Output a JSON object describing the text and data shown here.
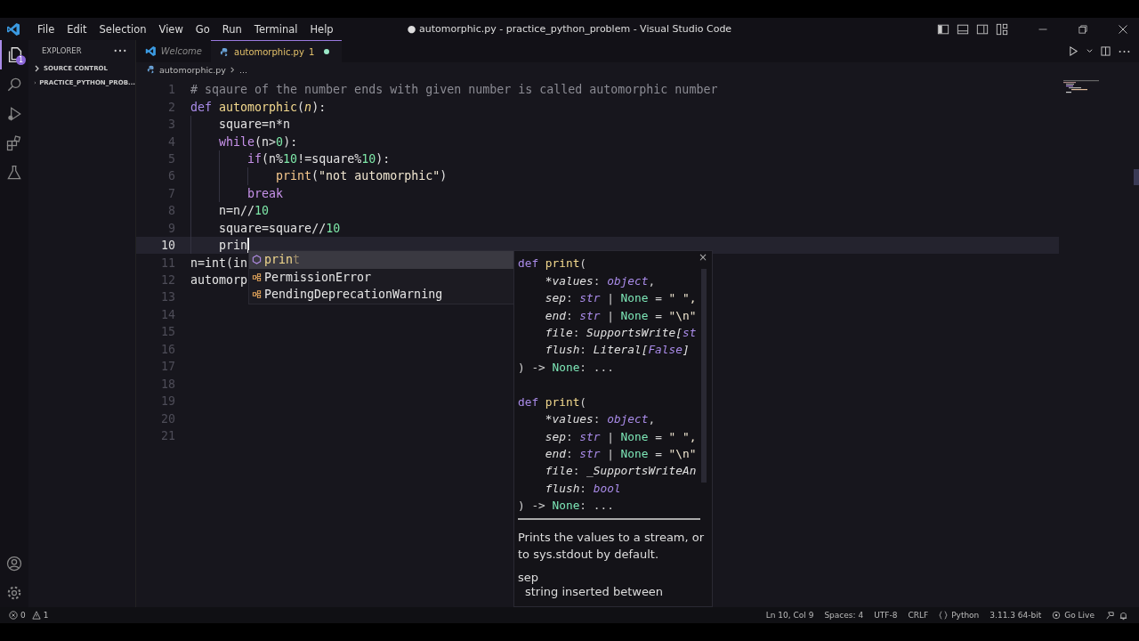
{
  "window": {
    "title": "● automorphic.py - practice_python_problem - Visual Studio Code"
  },
  "menu": [
    "File",
    "Edit",
    "Selection",
    "View",
    "Go",
    "Run",
    "Terminal",
    "Help"
  ],
  "activity_bar": {
    "explorer_badge": "1"
  },
  "sidebar": {
    "title": "EXPLORER",
    "items": [
      {
        "label": "SOURCE CONTROL",
        "expanded": false
      },
      {
        "label": "PRACTICE_PYTHON_PROB...",
        "expanded": false
      }
    ]
  },
  "tabs": [
    {
      "label": "Welcome",
      "kind": "welcome",
      "selected": false,
      "modified": false
    },
    {
      "label": "automorphic.py",
      "kind": "python",
      "selected": true,
      "problems": "1",
      "modified": true
    }
  ],
  "breadcrumb": [
    "automorphic.py",
    "..."
  ],
  "editor": {
    "lines": [
      {
        "number": "1",
        "current": false,
        "tokens": [
          {
            "kind": "cmt",
            "text": "# sqaure of the number ends with given number is called automorphic number"
          }
        ]
      },
      {
        "number": "2",
        "current": false,
        "tokens": [
          {
            "kind": "def",
            "text": "def "
          },
          {
            "kind": "fn",
            "text": "automorphic"
          },
          {
            "kind": "op",
            "text": "("
          },
          {
            "kind": "param",
            "text": "n"
          },
          {
            "kind": "op",
            "text": "):"
          }
        ]
      },
      {
        "number": "3",
        "current": false,
        "tokens": [
          {
            "kind": "var",
            "text": "    square"
          },
          {
            "kind": "op",
            "text": "="
          },
          {
            "kind": "var",
            "text": "n"
          },
          {
            "kind": "op",
            "text": "*"
          },
          {
            "kind": "var",
            "text": "n"
          }
        ]
      },
      {
        "number": "4",
        "current": false,
        "tokens": [
          {
            "kind": "kw",
            "text": "    while"
          },
          {
            "kind": "op",
            "text": "("
          },
          {
            "kind": "var",
            "text": "n"
          },
          {
            "kind": "op",
            "text": ">"
          },
          {
            "kind": "num",
            "text": "0"
          },
          {
            "kind": "op",
            "text": "):"
          }
        ]
      },
      {
        "number": "5",
        "current": false,
        "tokens": [
          {
            "kind": "kw",
            "text": "        if"
          },
          {
            "kind": "op",
            "text": "("
          },
          {
            "kind": "var",
            "text": "n"
          },
          {
            "kind": "op",
            "text": "%"
          },
          {
            "kind": "num",
            "text": "10"
          },
          {
            "kind": "op",
            "text": "!="
          },
          {
            "kind": "var",
            "text": "square"
          },
          {
            "kind": "op",
            "text": "%"
          },
          {
            "kind": "num",
            "text": "10"
          },
          {
            "kind": "op",
            "text": "):"
          }
        ]
      },
      {
        "number": "6",
        "current": false,
        "tokens": [
          {
            "kind": "call",
            "text": "            print"
          },
          {
            "kind": "op",
            "text": "("
          },
          {
            "kind": "str",
            "text": "\"not automorphic\""
          },
          {
            "kind": "op",
            "text": ")"
          }
        ]
      },
      {
        "number": "7",
        "current": false,
        "tokens": [
          {
            "kind": "kw",
            "text": "        break"
          }
        ]
      },
      {
        "number": "8",
        "current": false,
        "tokens": [
          {
            "kind": "var",
            "text": "    n"
          },
          {
            "kind": "op",
            "text": "="
          },
          {
            "kind": "var",
            "text": "n"
          },
          {
            "kind": "op",
            "text": "//"
          },
          {
            "kind": "num",
            "text": "10"
          }
        ]
      },
      {
        "number": "9",
        "current": false,
        "tokens": [
          {
            "kind": "var",
            "text": "    square"
          },
          {
            "kind": "op",
            "text": "="
          },
          {
            "kind": "var",
            "text": "square"
          },
          {
            "kind": "op",
            "text": "//"
          },
          {
            "kind": "num",
            "text": "10"
          }
        ]
      },
      {
        "number": "10",
        "current": true,
        "tokens": [
          {
            "kind": "var",
            "text": "    prin"
          }
        ]
      },
      {
        "number": "11",
        "current": false,
        "tokens": [
          {
            "kind": "var",
            "text": "n"
          },
          {
            "kind": "op",
            "text": "="
          },
          {
            "kind": "var",
            "text": "int"
          },
          {
            "kind": "op",
            "text": "("
          },
          {
            "kind": "var",
            "text": "in"
          }
        ]
      },
      {
        "number": "12",
        "current": false,
        "tokens": [
          {
            "kind": "var",
            "text": "automorp"
          }
        ]
      },
      {
        "number": "13",
        "current": false
      },
      {
        "number": "14",
        "current": false
      },
      {
        "number": "15",
        "current": false
      },
      {
        "number": "16",
        "current": false
      },
      {
        "number": "17",
        "current": false
      },
      {
        "number": "18",
        "current": false
      },
      {
        "number": "19",
        "current": false
      },
      {
        "number": "20",
        "current": false
      },
      {
        "number": "21",
        "current": false
      }
    ]
  },
  "suggestions": [
    {
      "kind": "method",
      "match": "prin",
      "rest": "t",
      "selected": true
    },
    {
      "kind": "class",
      "match": "P",
      "rest": "ermissionError",
      "selected": false
    },
    {
      "kind": "class",
      "match": "P",
      "rest": "endingDeprecationWarning",
      "selected": false
    }
  ],
  "hover": {
    "close": "×",
    "signatures": [
      [
        [
          {
            "kind": "def",
            "text": "def "
          },
          {
            "kind": "fn",
            "text": "print"
          },
          {
            "kind": "op",
            "text": "("
          }
        ],
        [
          {
            "kind": "ital",
            "text": "    *values"
          },
          {
            "kind": "op",
            "text": ": "
          },
          {
            "kind": "type",
            "text": "object"
          },
          {
            "kind": "op",
            "text": ","
          }
        ],
        [
          {
            "kind": "ital",
            "text": "    sep"
          },
          {
            "kind": "op",
            "text": ": "
          },
          {
            "kind": "type",
            "text": "str"
          },
          {
            "kind": "op",
            "text": " | "
          },
          {
            "kind": "none",
            "text": "None"
          },
          {
            "kind": "op",
            "text": " = "
          },
          {
            "kind": "str",
            "text": "\" \","
          }
        ],
        [
          {
            "kind": "ital",
            "text": "    end"
          },
          {
            "kind": "op",
            "text": ": "
          },
          {
            "kind": "type",
            "text": "str"
          },
          {
            "kind": "op",
            "text": " | "
          },
          {
            "kind": "none",
            "text": "None"
          },
          {
            "kind": "op",
            "text": " = "
          },
          {
            "kind": "str",
            "text": "\"\\n\""
          }
        ],
        [
          {
            "kind": "ital",
            "text": "    file"
          },
          {
            "kind": "op",
            "text": ": "
          },
          {
            "kind": "ital",
            "text": "SupportsWrite["
          },
          {
            "kind": "type",
            "text": "st"
          }
        ],
        [
          {
            "kind": "ital",
            "text": "    flush"
          },
          {
            "kind": "op",
            "text": ": "
          },
          {
            "kind": "ital",
            "text": "Literal["
          },
          {
            "kind": "type",
            "text": "False"
          },
          {
            "kind": "ital",
            "text": "]"
          }
        ],
        [
          {
            "kind": "op",
            "text": ") -> "
          },
          {
            "kind": "none",
            "text": "None"
          },
          {
            "kind": "op",
            "text": ": ..."
          }
        ]
      ],
      [
        [
          {
            "kind": "def",
            "text": "def "
          },
          {
            "kind": "fn",
            "text": "print"
          },
          {
            "kind": "op",
            "text": "("
          }
        ],
        [
          {
            "kind": "ital",
            "text": "    *values"
          },
          {
            "kind": "op",
            "text": ": "
          },
          {
            "kind": "type",
            "text": "object"
          },
          {
            "kind": "op",
            "text": ","
          }
        ],
        [
          {
            "kind": "ital",
            "text": "    sep"
          },
          {
            "kind": "op",
            "text": ": "
          },
          {
            "kind": "type",
            "text": "str"
          },
          {
            "kind": "op",
            "text": " | "
          },
          {
            "kind": "none",
            "text": "None"
          },
          {
            "kind": "op",
            "text": " = "
          },
          {
            "kind": "str",
            "text": "\" \","
          }
        ],
        [
          {
            "kind": "ital",
            "text": "    end"
          },
          {
            "kind": "op",
            "text": ": "
          },
          {
            "kind": "type",
            "text": "str"
          },
          {
            "kind": "op",
            "text": " | "
          },
          {
            "kind": "none",
            "text": "None"
          },
          {
            "kind": "op",
            "text": " = "
          },
          {
            "kind": "str",
            "text": "\"\\n\""
          }
        ],
        [
          {
            "kind": "ital",
            "text": "    file"
          },
          {
            "kind": "op",
            "text": ": "
          },
          {
            "kind": "ital",
            "text": "_SupportsWriteAn"
          }
        ],
        [
          {
            "kind": "ital",
            "text": "    flush"
          },
          {
            "kind": "op",
            "text": ": "
          },
          {
            "kind": "type",
            "text": "bool"
          }
        ],
        [
          {
            "kind": "op",
            "text": ") -> "
          },
          {
            "kind": "none",
            "text": "None"
          },
          {
            "kind": "op",
            "text": ": ..."
          }
        ]
      ]
    ],
    "description": "Prints the values to a stream, or to sys.stdout by default.",
    "param": "sep",
    "param_doc": "string inserted between"
  },
  "status_bar": {
    "errors": "0",
    "warnings": "1",
    "right": [
      "Ln 10, Col 9",
      "Spaces: 4",
      "UTF-8",
      "CRLF",
      "Python",
      "3.11.3 64-bit",
      "Go Live"
    ]
  }
}
